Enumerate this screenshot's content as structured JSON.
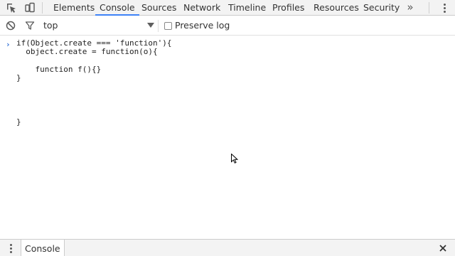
{
  "tabs": [
    {
      "label": "Elements"
    },
    {
      "label": "Console"
    },
    {
      "label": "Sources"
    },
    {
      "label": "Network"
    },
    {
      "label": "Timeline"
    },
    {
      "label": "Profiles"
    },
    {
      "label": "Resources"
    },
    {
      "label": "Security"
    }
  ],
  "selected_tab": "Console",
  "overflow_label": "»",
  "toolbar": {
    "context": "top",
    "preserve_log_label": "Preserve log",
    "preserve_log_checked": false
  },
  "console": {
    "prompt_symbol": "›",
    "lines": [
      "if(Object.create === 'function'){",
      "  object.create = function(o){",
      "",
      "    function f(){}",
      "}",
      "",
      "",
      "",
      "",
      "}"
    ]
  },
  "drawer": {
    "tab_label": "Console"
  },
  "colors": {
    "accent": "#3e82f7",
    "prompt": "#2f6fd6",
    "toolbar_bg": "#f3f3f3"
  },
  "icons": [
    "inspect-element-icon",
    "device-mode-icon",
    "clear-console-icon",
    "filter-icon",
    "dropdown-arrow-icon",
    "overflow-chevron-icon",
    "kebab-menu-icon",
    "close-icon",
    "mouse-cursor-icon"
  ]
}
